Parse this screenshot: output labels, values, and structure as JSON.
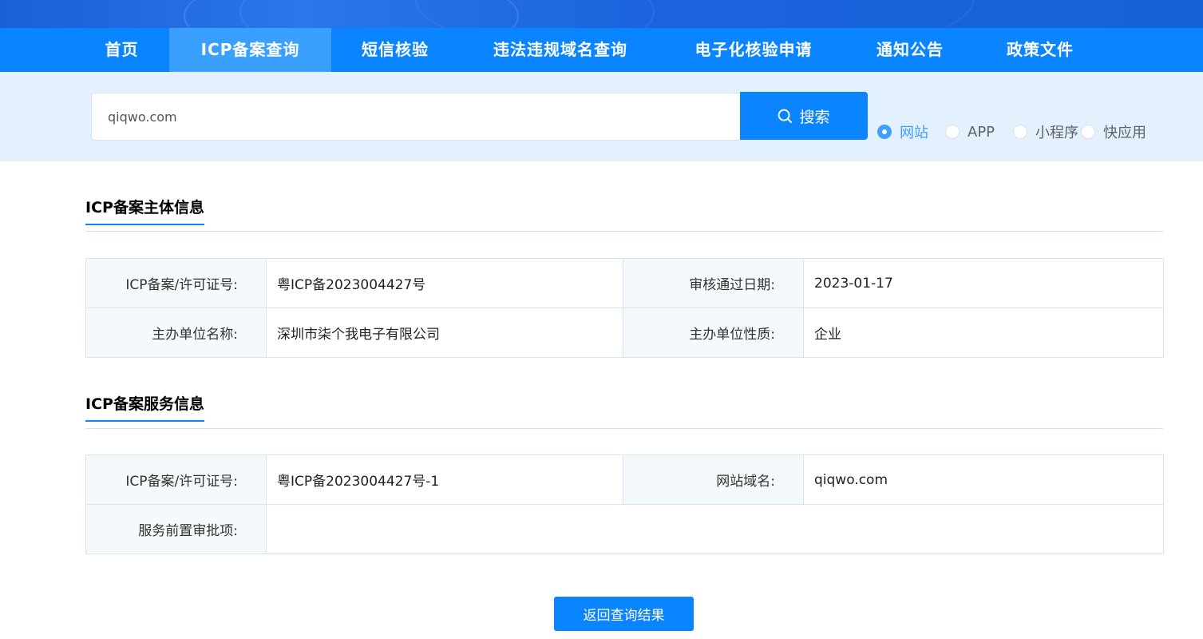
{
  "nav": {
    "items": [
      {
        "label": "首页"
      },
      {
        "label": "ICP备案查询"
      },
      {
        "label": "短信核验"
      },
      {
        "label": "违法违规域名查询"
      },
      {
        "label": "电子化核验申请"
      },
      {
        "label": "通知公告"
      },
      {
        "label": "政策文件"
      }
    ],
    "active": "ICP备案查询"
  },
  "search": {
    "value": "qiqwo.com",
    "button_label": "搜索",
    "button_icon": "search-icon",
    "types": [
      {
        "label": "网站",
        "checked": true
      },
      {
        "label": "APP",
        "checked": false
      },
      {
        "label": "小程序",
        "checked": false
      },
      {
        "label": "快应用",
        "checked": false
      }
    ]
  },
  "subject": {
    "title": "ICP备案主体信息",
    "rows": [
      {
        "label1": "ICP备案/许可证号:",
        "value1": "粤ICP备2023004427号",
        "label2": "审核通过日期:",
        "value2": "2023-01-17"
      },
      {
        "label1": "主办单位名称:",
        "value1": "深圳市柒个我电子有限公司",
        "label2": "主办单位性质:",
        "value2": "企业"
      }
    ]
  },
  "service": {
    "title": "ICP备案服务信息",
    "row1": {
      "label1": "ICP备案/许可证号:",
      "value1": "粤ICP备2023004427号-1",
      "label2": "网站域名:",
      "value2": "qiqwo.com"
    },
    "row2": {
      "label": "服务前置审批项:",
      "value": ""
    }
  },
  "back_button": "返回查询结果",
  "colors": {
    "primary": "#0a84ff",
    "nav_active": "#3aa0ff",
    "search_band": "#e3f1fe",
    "label_bg": "#f4f9fc"
  }
}
